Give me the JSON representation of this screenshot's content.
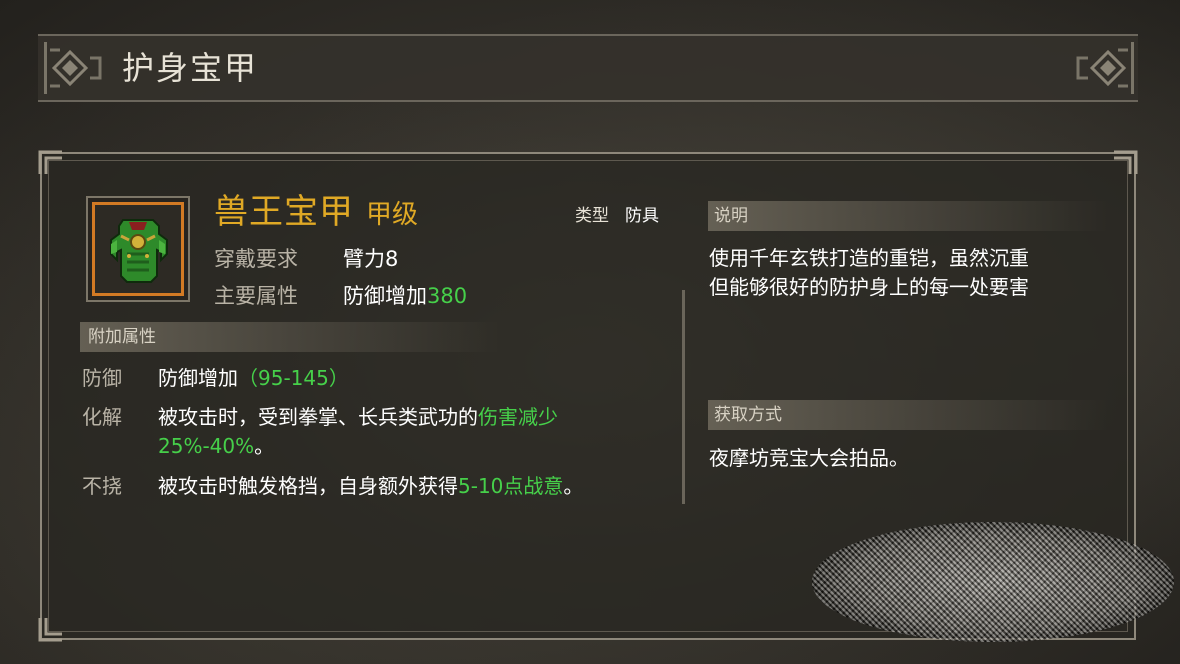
{
  "window": {
    "title": "护身宝甲"
  },
  "item": {
    "name": "兽王宝甲",
    "grade": "甲级",
    "type_label": "类型",
    "type_value": "防具",
    "req_label": "穿戴要求",
    "req_value": "臂力8",
    "main_label": "主要属性",
    "main_value_prefix": "防御增加",
    "main_value_number": "380",
    "icon": "green-armor-icon"
  },
  "bonus": {
    "header": "附加属性",
    "rows": [
      {
        "label": "防御",
        "text": "防御增加",
        "highlight": "（95-145）",
        "text_after": ""
      },
      {
        "label": "化解",
        "text": "被攻击时，受到拳掌、长兵类武功的",
        "highlight": "伤害减少",
        "line2": "25%-40%",
        "line2_after": "。"
      },
      {
        "label": "不挠",
        "text": "被攻击时触发格挡，自身额外获得",
        "highlight": "5-10点战意",
        "text_after": "。"
      }
    ]
  },
  "description": {
    "header": "说明",
    "lines": [
      "使用千年玄铁打造的重铠，虽然沉重",
      "但能够很好的防护身上的每一处要害"
    ]
  },
  "obtain": {
    "header": "获取方式",
    "text": "夜摩坊竞宝大会拍品。"
  },
  "colors": {
    "gold": "#e0a925",
    "green": "#46d04a",
    "orange_frame": "#d27a24",
    "label_gray": "#b9b3a6"
  }
}
